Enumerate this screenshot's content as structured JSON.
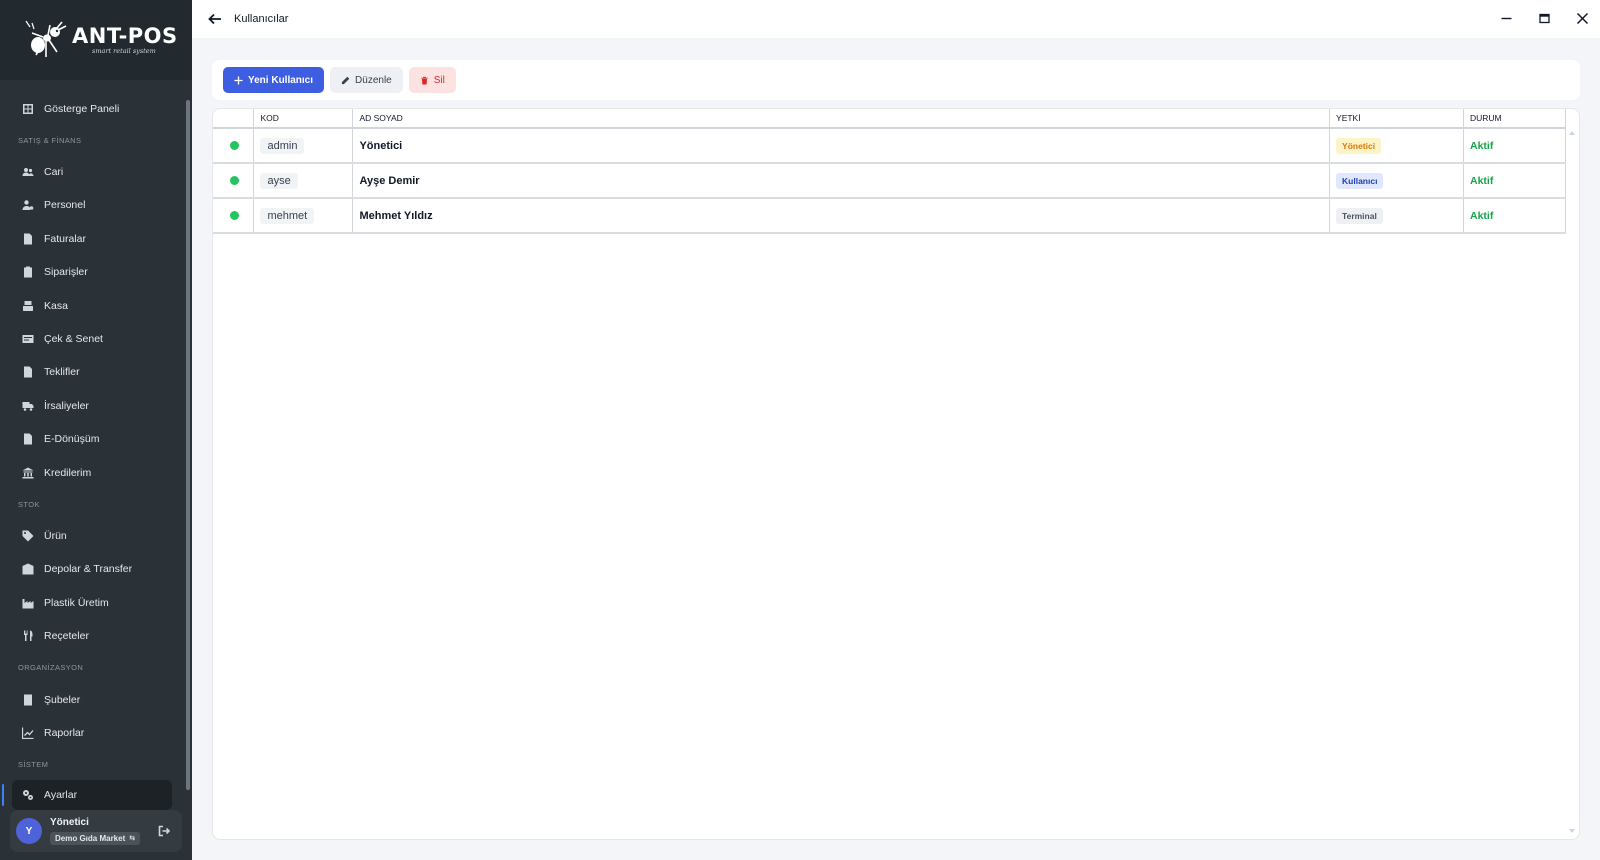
{
  "app": {
    "logo_title": "ANT-POS",
    "logo_subtitle": "smart retail system"
  },
  "topbar": {
    "title": "Kullanıcılar"
  },
  "sidebar": {
    "dashboard": "Gösterge Paneli",
    "sections": {
      "sales": "SATIŞ & FİNANS",
      "stock": "STOK",
      "org": "ORGANİZASYON",
      "system": "SİSTEM"
    },
    "items": {
      "cari": "Cari",
      "personel": "Personel",
      "faturalar": "Faturalar",
      "siparisler": "Siparişler",
      "kasa": "Kasa",
      "cek": "Çek & Senet",
      "teklifler": "Teklifler",
      "irsaliyeler": "İrsaliyeler",
      "edonusum": "E-Dönüşüm",
      "kredilerim": "Kredilerim",
      "urun": "Ürün",
      "depolar": "Depolar & Transfer",
      "plastik": "Plastik Üretim",
      "receteler": "Reçeteler",
      "subeler": "Şubeler",
      "raporlar": "Raporlar",
      "ayarlar": "Ayarlar"
    },
    "user": {
      "initial": "Y",
      "name": "Yönetici",
      "store": "Demo Gıda Market"
    }
  },
  "toolbar": {
    "new_label": "Yeni Kullanıcı",
    "edit_label": "Düzenle",
    "delete_label": "Sil"
  },
  "table": {
    "columns": [
      "",
      "KOD",
      "AD SOYAD",
      "YETKİ",
      "DURUM"
    ],
    "rows": [
      {
        "code": "admin",
        "name": "Yönetici",
        "role": "Yönetici",
        "status": "Aktif"
      },
      {
        "code": "ayse",
        "name": "Ayşe Demir",
        "role": "Kullanıcı",
        "status": "Aktif"
      },
      {
        "code": "mehmet",
        "name": "Mehmet Yıldız",
        "role": "Terminal",
        "status": "Aktif"
      }
    ]
  },
  "colors": {
    "accent": "#3d5ee0",
    "sidebar_bg": "#2b3237",
    "status_active": "#16a34a",
    "danger": "#dc2626"
  }
}
